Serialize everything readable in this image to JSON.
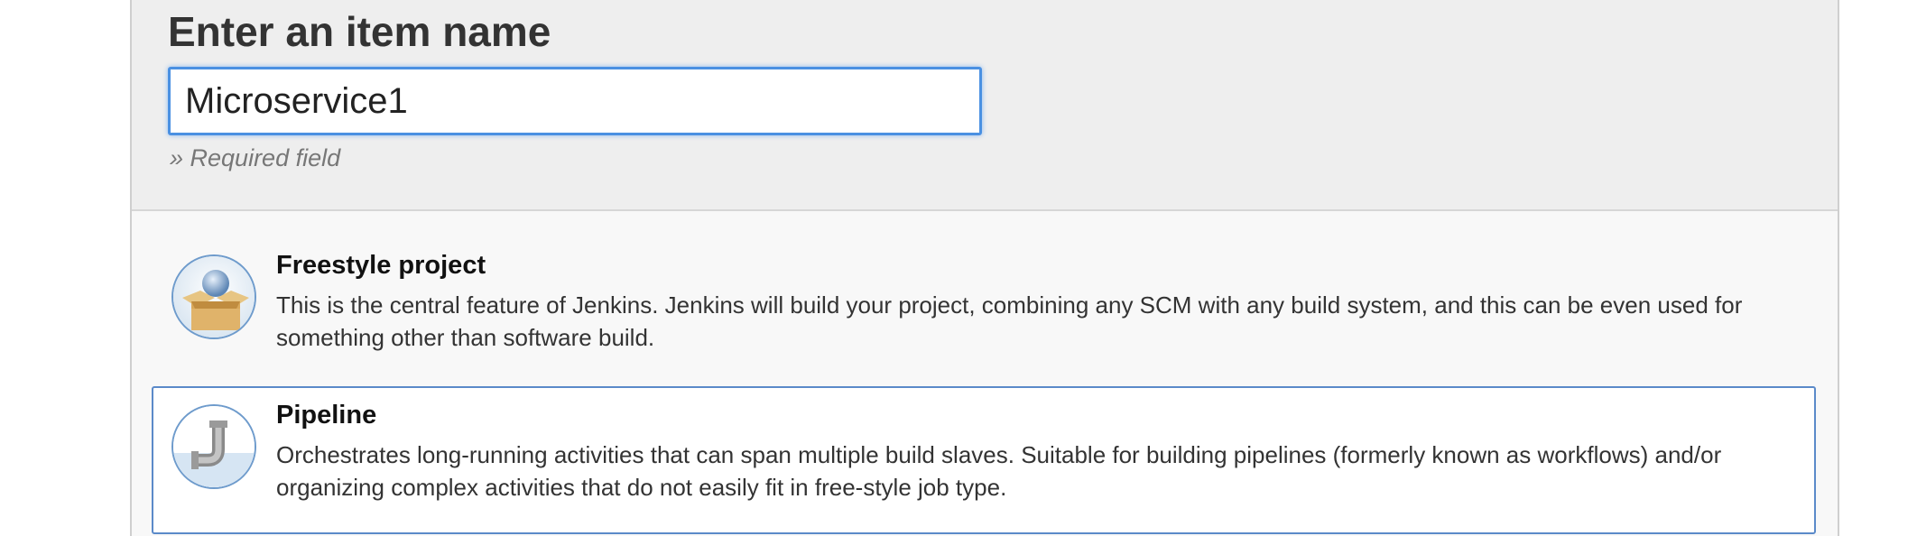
{
  "page": {
    "title": "Enter an item name",
    "item_name_value": "Microservice1",
    "required_hint": "» Required field"
  },
  "item_types": [
    {
      "title": "Freestyle project",
      "description": "This is the central feature of Jenkins. Jenkins will build your project, combining any SCM with any build system, and this can be even used for something other than software build.",
      "icon": "freestyle-box-icon",
      "selected": false
    },
    {
      "title": "Pipeline",
      "description": "Orchestrates long-running activities that can span multiple build slaves. Suitable for building pipelines (formerly known as workflows) and/or organizing complex activities that do not easily fit in free-style job type.",
      "icon": "pipeline-pipe-icon",
      "selected": true
    }
  ],
  "colors": {
    "input_focus_border": "#4a90e2",
    "selected_item_border": "#5b8ac9",
    "header_background": "#eeeeee"
  }
}
